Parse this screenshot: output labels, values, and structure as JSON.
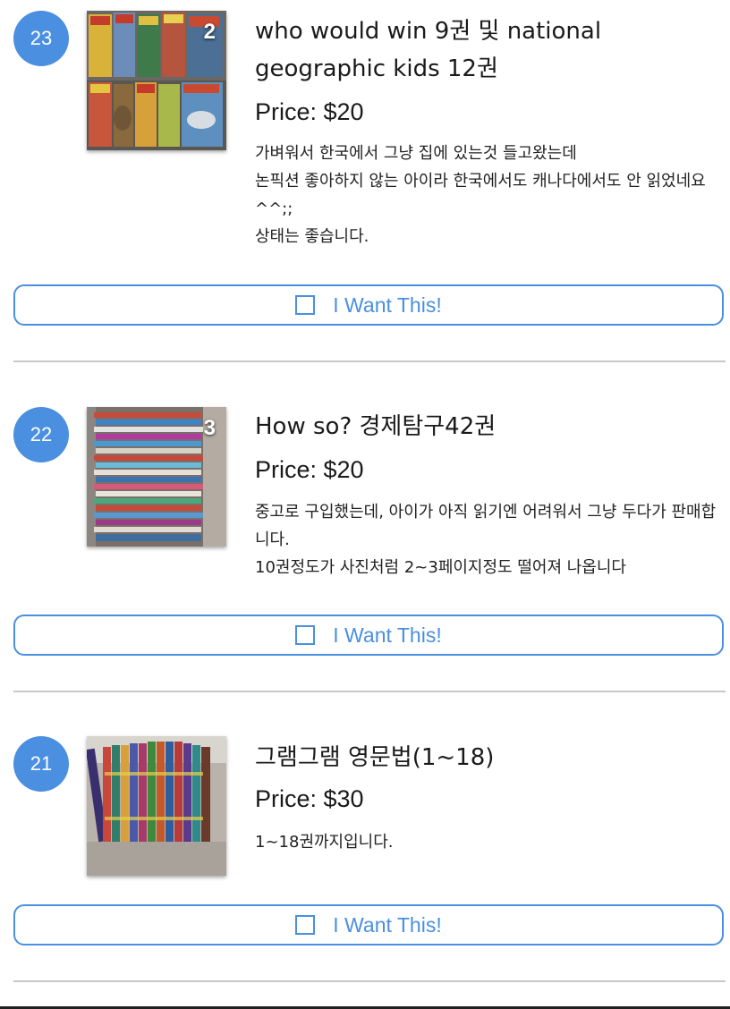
{
  "listings": [
    {
      "number": "23",
      "photo_count": "2",
      "title": "who would win 9권 및 national geographic kids 12권",
      "price": "Price: $20",
      "description": "가벼워서 한국에서 그냥 집에 있는것 들고왔는데\n논픽션 좋아하지 않는 아이라 한국에서도 캐나다에서도 안 읽었네요 ^^;;\n상태는 좋습니다.",
      "button_label": "I Want This!"
    },
    {
      "number": "22",
      "photo_count": "3",
      "title": "How so? 경제탐구42권",
      "price": "Price: $20",
      "description": "중고로 구입했는데, 아이가 아직 읽기엔 어려워서 그냥 두다가 판매합니다.\n10권정도가 사진처럼 2~3페이지정도 떨어져 나옵니다",
      "button_label": "I Want This!"
    },
    {
      "number": "21",
      "photo_count": "",
      "title": "그램그램 영문법(1~18)",
      "price": "Price: $30",
      "description": "1~18권까지입니다.",
      "button_label": "I Want This!"
    }
  ],
  "colors": {
    "accent": "#4a8fe0",
    "divider": "#c8c8c8",
    "text": "#1a1a1a"
  }
}
